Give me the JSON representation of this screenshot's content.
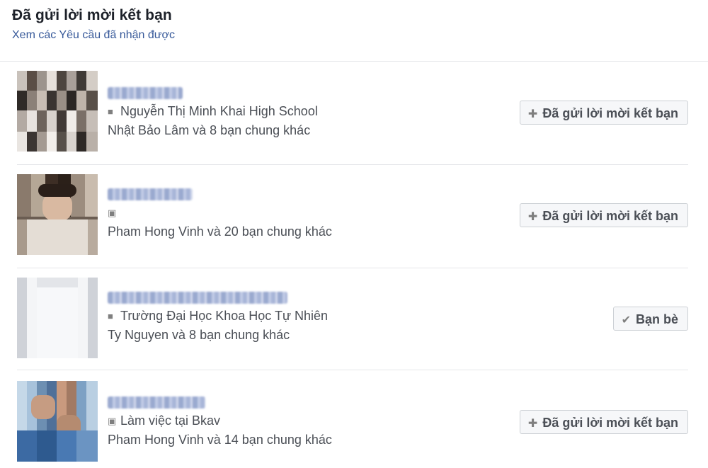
{
  "header": {
    "title": "Đã gửi lời mời kết bạn",
    "link": "Xem các Yêu cầu đã nhận được"
  },
  "requests": [
    {
      "info_icon": "school-icon",
      "info_text": "Nguyễn Thị Minh Khai High School",
      "mutual_text": "Nhật Bảo Lâm và 8 bạn chung khác",
      "button_label": "Đã gửi lời mời kết bạn",
      "button_icon": "friend-request-sent-icon"
    },
    {
      "info_icon": "city-icon",
      "info_text": "",
      "mutual_text": "Pham Hong Vinh và 20 bạn chung khác",
      "button_label": "Đã gửi lời mời kết bạn",
      "button_icon": "friend-request-sent-icon"
    },
    {
      "info_icon": "school-icon",
      "info_text": "Trường Đại Học Khoa Học Tự Nhiên",
      "mutual_text": "Ty Nguyen và 8 bạn chung khác",
      "button_label": "Bạn bè",
      "button_icon": "check-icon"
    },
    {
      "info_icon": "briefcase-icon",
      "info_text": "Làm việc tại Bkav",
      "mutual_text": "Pham Hong Vinh và 14 bạn chung khác",
      "button_label": "Đã gửi lời mời kết bạn",
      "button_icon": "friend-request-sent-icon"
    }
  ]
}
